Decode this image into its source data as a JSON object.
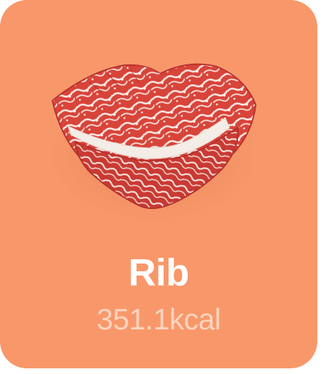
{
  "card": {
    "background": "#F8986A",
    "title": "Rib",
    "subtitle": "351.1kcal",
    "image_icon": "marbled-beef-rib-image"
  }
}
